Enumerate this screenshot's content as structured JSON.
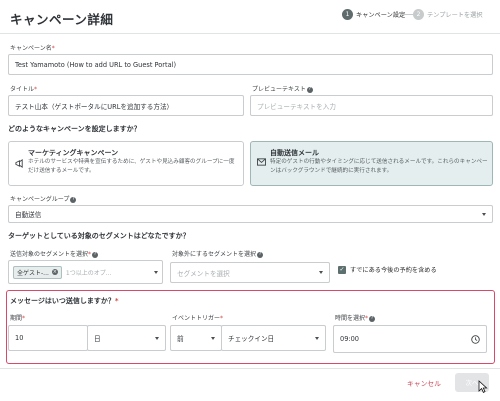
{
  "page": {
    "title": "キャンペーン詳細"
  },
  "steps": [
    {
      "num": "1",
      "label": "キャンペーン設定"
    },
    {
      "num": "2",
      "label": "テンプレートを選択"
    }
  ],
  "campaign_name": {
    "label": "キャンペーン名",
    "value": "Test Yamamoto (How to add URL to Guest Portal)"
  },
  "subject": {
    "label": "タイトル",
    "value": "テスト山本（ゲストポータルにURLを追加する方法）"
  },
  "preview_text": {
    "label": "プレビューテキスト",
    "placeholder": "プレビューテキストを入力"
  },
  "campaign_type": {
    "question": "どのようなキャンペーンを設定しますか？",
    "options": [
      {
        "title": "マーケティングキャンペーン",
        "desc": "ホテルのサービスや特典を宣伝するために、ゲストや見込み顧客のグループに一度だけ送信するメールです。",
        "icon": "megaphone-icon"
      },
      {
        "title": "自動送信メール",
        "desc": "特定のゲストの行動やタイミングに応じて送信されるメールです。これらのキャンペーンはバックグラウンドで継続的に実行されます。",
        "icon": "mail-icon"
      }
    ]
  },
  "campaign_group": {
    "label": "キャンペーングループ",
    "value": "自動送信"
  },
  "segments": {
    "question": "ターゲットとしている対象のセグメントはどなたですか？",
    "target_label": "送信対象のセグメントを選択",
    "chip": "全ゲスト-...",
    "more": "1つ以上のオプ...",
    "exclude_label": "対象外にするセグメントを選択",
    "exclude_placeholder": "セグメントを選択",
    "checkbox_label": "すでにある今後の予約を含める"
  },
  "when": {
    "question": "メッセージはいつ送信しますか？",
    "period_label": "期間",
    "period_value": "10",
    "unit_value": "日",
    "trigger_label": "イベントトリガー",
    "before_value": "前",
    "event_value": "チェックイン日",
    "time_label": "時間を選択",
    "time_value": "09:00"
  },
  "footer": {
    "cancel": "キャンセル",
    "next": "次へ"
  },
  "colors": {
    "highlight_border": "#d74a6a",
    "selected_card": "#e4eeee",
    "cancel_text": "#c94a58"
  }
}
